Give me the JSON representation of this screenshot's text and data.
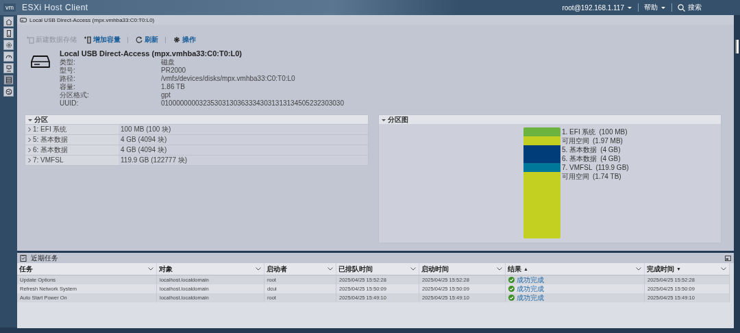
{
  "header": {
    "logo": "vm",
    "title": "ESXi Host Client",
    "user": "root@192.168.1.117",
    "help": "帮助",
    "search": "搜索"
  },
  "sidebar": [
    {
      "selected": false
    },
    {
      "selected": false
    },
    {
      "selected": false
    },
    {
      "selected": false
    },
    {
      "selected": false
    },
    {
      "selected": true
    },
    {
      "selected": false
    }
  ],
  "breadcrumb": "Local USB Direct-Access (mpx.vmhba33:C0:T0:L0)",
  "toolbar": [
    {
      "kind": "new",
      "label": "新建数据存储",
      "disabled": true
    },
    {
      "kind": "grow",
      "label": "增加容量",
      "disabled": false
    },
    {
      "kind": "refresh",
      "label": "刷新",
      "disabled": false
    },
    {
      "kind": "actions",
      "label": "操作",
      "disabled": false
    }
  ],
  "disk": {
    "name": "Local USB Direct-Access (mpx.vmhba33:C0:T0:L0)",
    "properties": [
      {
        "label": "类型:",
        "value": "磁盘"
      },
      {
        "label": "型号:",
        "value": "PR2000"
      },
      {
        "label": "路径:",
        "value": "/vmfs/devices/disks/mpx.vmhba33:C0:T0:L0"
      },
      {
        "label": "容量:",
        "value": "1.86 TB"
      },
      {
        "label": "分区格式:",
        "value": "gpt"
      },
      {
        "label": "UUID:",
        "value": "010000000032353031303633343031313134505232303030"
      }
    ]
  },
  "partitions": {
    "title": "分区",
    "expanded": true,
    "rows": [
      {
        "name": "1: EFI 系统",
        "size": "100 MB (100 块)",
        "expanded": false
      },
      {
        "name": "5: 基本数据",
        "size": "4 GB (4094 块)",
        "expanded": false
      },
      {
        "name": "6: 基本数据",
        "size": "4 GB (4094 块)",
        "expanded": false
      },
      {
        "name": "7: VMFSL",
        "size": "119.9 GB (122777 块)",
        "expanded": false
      }
    ]
  },
  "partition_map": {
    "title": "分区图",
    "expanded": true,
    "segments": [
      {
        "name": "1. EFI 系统",
        "size": "(100 MB)",
        "color": "#6cb33f"
      },
      {
        "name": "可用空间",
        "size": "(1.97 MB)",
        "color": "#c3cf21"
      },
      {
        "name": "5. 基本数据",
        "size": "(4 GB)",
        "color": "#003d79"
      },
      {
        "name": "6. 基本数据",
        "size": "(4 GB)",
        "color": "#003d79"
      },
      {
        "name": "7. VMFSL",
        "size": "(119.9 GB)",
        "color": "#00789a"
      },
      {
        "name": "可用空间",
        "size": "(1.74 TB)",
        "color": "#c3cf21"
      }
    ]
  },
  "tasks": {
    "title": "近期任务",
    "columns": [
      {
        "label": "任务"
      },
      {
        "label": "对象"
      },
      {
        "label": "启动者"
      },
      {
        "label": "已排队时间"
      },
      {
        "label": "启动时间"
      },
      {
        "label": "结果",
        "sort_mark": "▲"
      },
      {
        "label": "完成时间",
        "sort_mark": "▼"
      }
    ],
    "rows": [
      {
        "task": "Update Options",
        "target": "localhost.localdomain",
        "initiator": "root",
        "queued": "2025/04/25 15:52:28",
        "started": "2025/04/25 15:52:28",
        "result": "成功完成",
        "completed": "2025/04/25 15:52:28"
      },
      {
        "task": "Refresh Network System",
        "target": "localhost.localdomain",
        "initiator": "dcui",
        "queued": "2025/04/25 15:50:09",
        "started": "2025/04/25 15:50:09",
        "result": "成功完成",
        "completed": "2025/04/25 15:50:09"
      },
      {
        "task": "Auto Start Power On",
        "target": "localhost.localdomain",
        "initiator": "root",
        "queued": "2025/04/25 15:49:10",
        "started": "2025/04/25 15:49:10",
        "result": "成功完成",
        "completed": "2025/04/25 15:49:10"
      }
    ]
  }
}
